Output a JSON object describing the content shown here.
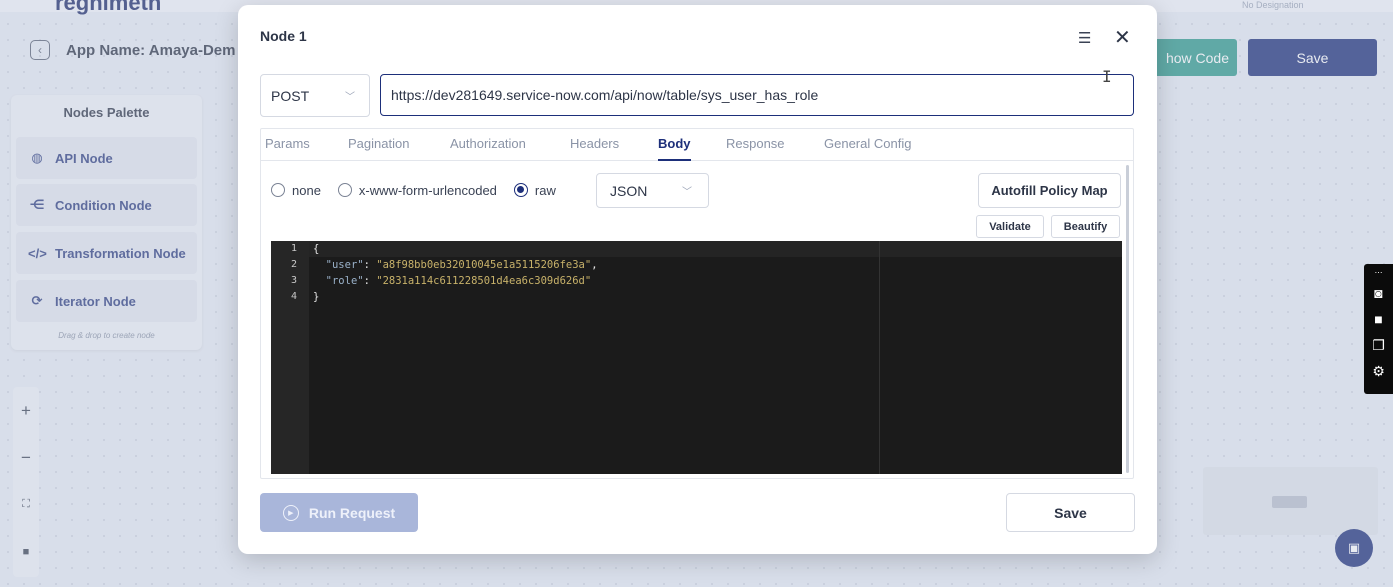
{
  "header": {
    "brand_fragment": "regnimeth",
    "designation": "No Designation",
    "app_name": "App Name: Amaya-Dem",
    "show_code_label": "how Code",
    "save_label": "Save"
  },
  "palette": {
    "title": "Nodes Palette",
    "items": [
      {
        "label": "API Node",
        "icon": "globe-icon"
      },
      {
        "label": "Condition Node",
        "icon": "branch-icon"
      },
      {
        "label": "Transformation Node",
        "icon": "code-icon"
      },
      {
        "label": "Iterator Node",
        "icon": "loop-icon"
      }
    ],
    "hint": "Drag & drop to create node"
  },
  "zoom": {
    "plus": "+",
    "minus": "−"
  },
  "modal": {
    "title": "Node 1",
    "method": "POST",
    "url": "https://dev281649.service-now.com/api/now/table/sys_user_has_role",
    "tabs": [
      "Params",
      "Pagination",
      "Authorization",
      "Headers",
      "Body",
      "Response",
      "General Config"
    ],
    "active_tab": "Body",
    "body_types": [
      "none",
      "x-www-form-urlencoded",
      "raw"
    ],
    "selected_body_type": "raw",
    "format": "JSON",
    "autofill_label": "Autofill Policy Map",
    "validate_label": "Validate",
    "beautify_label": "Beautify",
    "code": {
      "line_numbers": [
        "1",
        "2",
        "3",
        "4"
      ],
      "open_brace": "{",
      "user_key": "\"user\"",
      "user_value": "\"a8f98bb0eb32010045e1a5115206fe3a\"",
      "role_key": "\"role\"",
      "role_value": "\"2831a114c611228501d4ea6c309d626d\"",
      "close_brace": "}"
    },
    "run_label": "Run Request",
    "save_label": "Save"
  },
  "colors": {
    "primary": "#1d2f7a",
    "teal": "#2f9a8d",
    "editor_bg": "#1b1b1b"
  }
}
